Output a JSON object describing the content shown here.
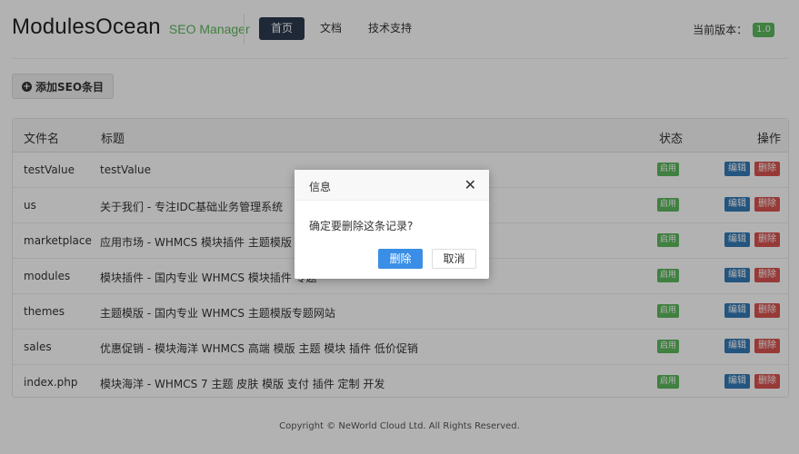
{
  "header": {
    "brand": "ModulesOcean",
    "brand_sub": "SEO Manager",
    "nav": [
      {
        "label": "首页",
        "active": true
      },
      {
        "label": "文档",
        "active": false
      },
      {
        "label": "技术支持",
        "active": false
      }
    ],
    "version_label": "当前版本：",
    "version_value": "1.0"
  },
  "toolbar": {
    "add_label": "添加SEO条目"
  },
  "table": {
    "columns": [
      "文件名",
      "标题",
      "状态",
      "操作"
    ],
    "rows": [
      {
        "file": "testValue",
        "title": "testValue",
        "status": "启用",
        "edit": "编辑",
        "delete": "删除"
      },
      {
        "file": "us",
        "title": "关于我们 - 专注IDC基础业务管理系统",
        "status": "启用",
        "edit": "编辑",
        "delete": "删除"
      },
      {
        "file": "marketplace",
        "title": "应用市场 - WHMCS 模块插件 主题模版 应用",
        "status": "启用",
        "edit": "编辑",
        "delete": "删除"
      },
      {
        "file": "modules",
        "title": "模块插件 - 国内专业 WHMCS 模块插件 专题",
        "status": "启用",
        "edit": "编辑",
        "delete": "删除"
      },
      {
        "file": "themes",
        "title": "主题模版 - 国内专业 WHMCS 主题模版专题网站",
        "status": "启用",
        "edit": "编辑",
        "delete": "删除"
      },
      {
        "file": "sales",
        "title": "优惠促销 - 模块海洋 WHMCS 高端 模版 主题 模块 插件 低价促销",
        "status": "启用",
        "edit": "编辑",
        "delete": "删除"
      },
      {
        "file": "index.php",
        "title": "模块海洋 - WHMCS 7 主题 皮肤 模版 支付 插件 定制 开发",
        "status": "启用",
        "edit": "编辑",
        "delete": "删除"
      }
    ]
  },
  "footer": {
    "copyright": "Copyright © NeWorld Cloud Ltd. All Rights Reserved."
  },
  "dialog": {
    "title": "信息",
    "message": "确定要删除这条记录?",
    "confirm_label": "删除",
    "cancel_label": "取消"
  },
  "colors": {
    "nav_active": "#2b3a4f",
    "success": "#5cb85c",
    "primary": "#337ab7",
    "danger": "#d9534f",
    "dialog_primary": "#3a8ee6"
  }
}
